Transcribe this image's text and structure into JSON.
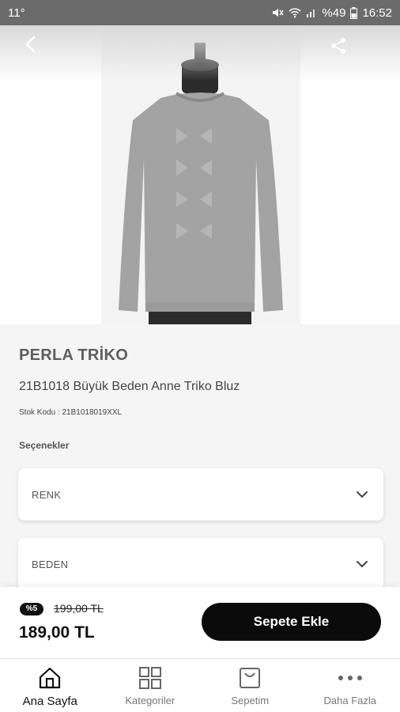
{
  "status_bar": {
    "left_text": "11°",
    "battery_text": "%49",
    "time": "16:52"
  },
  "icons": {
    "back": "back-arrow-icon",
    "share": "share-icon",
    "chevron": "chevron-down-icon",
    "home": "home-icon",
    "categories": "grid-icon",
    "cart": "shopping-bag-icon",
    "more": "more-dots-icon"
  },
  "product": {
    "brand": "PERLA TRİKO",
    "name": "21B1018 Büyük Beden Anne Triko Bluz",
    "stock_code": "Stok Kodu : 21B1018019XXL",
    "image_color": "#9e9e9e"
  },
  "options": {
    "title": "Seçenekler",
    "color_label": "RENK",
    "size_label": "BEDEN"
  },
  "pricing": {
    "discount_badge": "%5",
    "old_price": "199,00 TL",
    "new_price": "189,00 TL",
    "add_to_cart": "Sepete Ekle"
  },
  "bottom_nav": {
    "home": "Ana Sayfa",
    "categories": "Kategoriler",
    "cart": "Sepetim",
    "more": "Daha Fazla",
    "active": "home"
  }
}
